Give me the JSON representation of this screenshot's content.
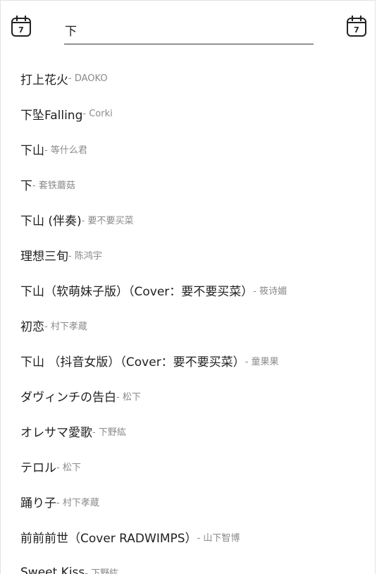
{
  "header": {
    "left_icon": "calendar-icon",
    "left_icon_day": "7",
    "right_icon": "calendar-icon",
    "right_icon_day": "7",
    "search": {
      "value": "下",
      "placeholder": ""
    }
  },
  "results": [
    {
      "title": "打上花火",
      "artist": "- DAOKO"
    },
    {
      "title": "下坠Falling",
      "artist": "- Corki"
    },
    {
      "title": "下山",
      "artist": "- 等什么君"
    },
    {
      "title": "下",
      "artist": "- 套铁蘑菇"
    },
    {
      "title": "下山 (伴奏)",
      "artist": "- 要不要买菜"
    },
    {
      "title": "理想三旬",
      "artist": "- 陈鸿宇"
    },
    {
      "title": "下山（软萌妹子版）（Cover：要不要买菜）",
      "artist": " - 筱诗媚"
    },
    {
      "title": "初恋",
      "artist": "- 村下孝蔵"
    },
    {
      "title": "下山 （抖音女版）（Cover：要不要买菜）",
      "artist": " - 童果果"
    },
    {
      "title": "ダヴィンチの告白",
      "artist": "- 松下"
    },
    {
      "title": "オレサマ愛歌",
      "artist": "- 下野紘"
    },
    {
      "title": "テロル",
      "artist": "- 松下"
    },
    {
      "title": "踊り子",
      "artist": "- 村下孝蔵"
    },
    {
      "title": "前前前世（Cover RADWIMPS）",
      "artist": " - 山下智博"
    },
    {
      "title": "Sweet Kiss",
      "artist": "- 下野紘"
    }
  ]
}
